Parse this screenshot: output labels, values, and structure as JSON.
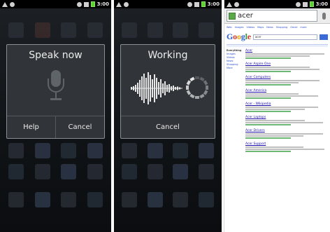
{
  "status_bar": {
    "time": "3:00"
  },
  "panel_speak": {
    "title": "Speak now",
    "help_label": "Help",
    "cancel_label": "Cancel"
  },
  "panel_working": {
    "title": "Working",
    "cancel_label": "Cancel"
  },
  "panel_browser": {
    "address_text": "acer",
    "logo": "Google",
    "search_query": "acer",
    "nav_links": [
      "Web",
      "Images",
      "Videos",
      "Maps",
      "News",
      "Shopping",
      "Gmail",
      "more"
    ],
    "sidebar": {
      "heading": "Everything",
      "items": [
        "Images",
        "Videos",
        "News",
        "Shopping",
        "More"
      ]
    },
    "results": [
      "Acer",
      "Acer Aspire One",
      "Acer Computers",
      "Acer America",
      "Acer - Wikipedia",
      "Acer Laptops",
      "Acer Drivers",
      "Acer Support"
    ]
  },
  "colors": {
    "dialog_bg": "#34373b",
    "dialog_border": "#8a8f96",
    "battery": "#5ad22e",
    "link": "#1a0dab",
    "url_green": "#2f9a3a"
  }
}
